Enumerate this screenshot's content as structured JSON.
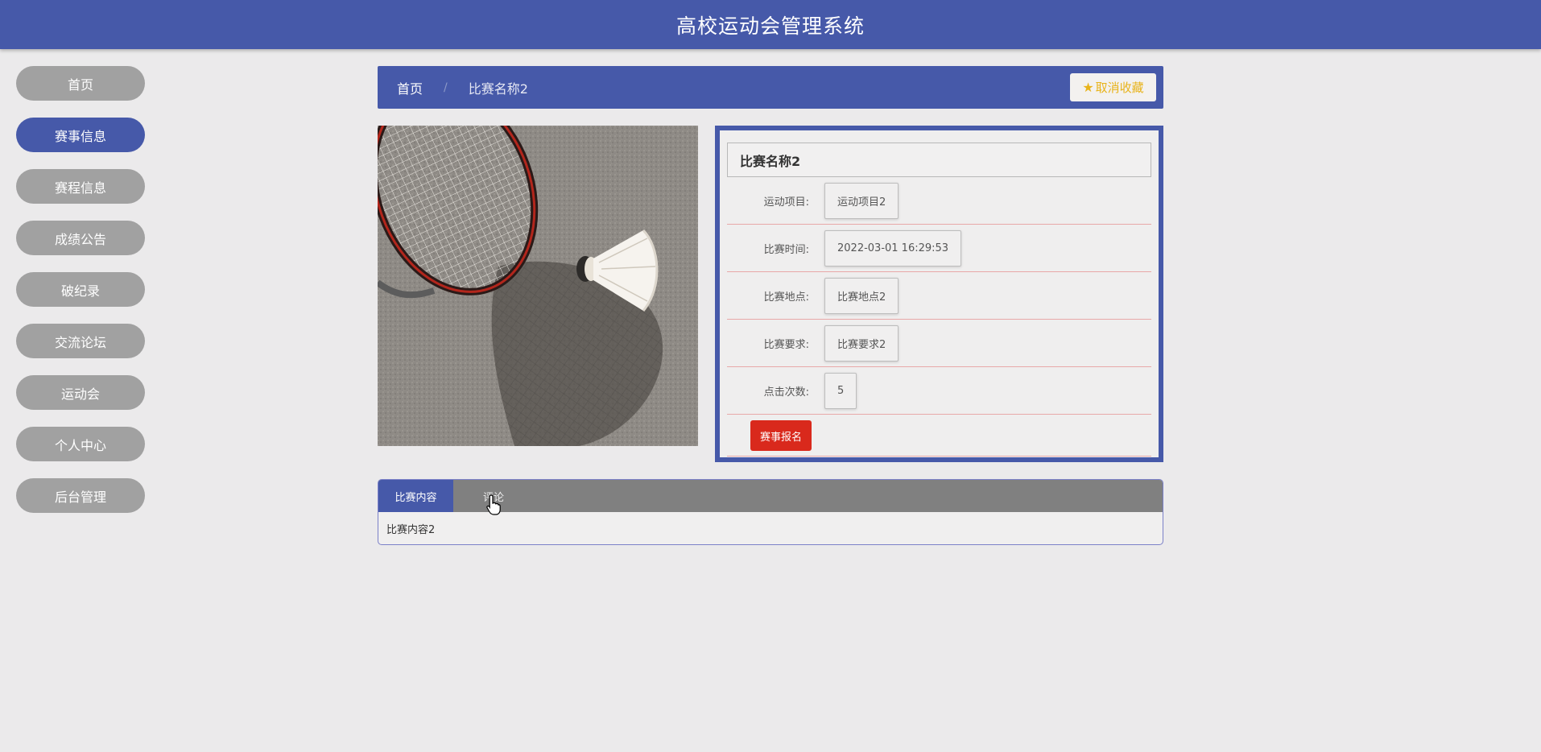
{
  "header": {
    "title": "高校运动会管理系统"
  },
  "sidebar": {
    "items": [
      {
        "label": "首页",
        "active": false
      },
      {
        "label": "赛事信息",
        "active": true
      },
      {
        "label": "赛程信息",
        "active": false
      },
      {
        "label": "成绩公告",
        "active": false
      },
      {
        "label": "破纪录",
        "active": false
      },
      {
        "label": "交流论坛",
        "active": false
      },
      {
        "label": "运动会",
        "active": false
      },
      {
        "label": "个人中心",
        "active": false
      },
      {
        "label": "后台管理",
        "active": false
      }
    ]
  },
  "breadcrumb": {
    "home": "首页",
    "separator": "/",
    "current": "比赛名称2"
  },
  "favorite": {
    "icon": "star-icon",
    "label": "取消收藏"
  },
  "detail": {
    "title": "比赛名称2",
    "rows": [
      {
        "label": "运动项目:",
        "value": "运动项目2"
      },
      {
        "label": "比赛时间:",
        "value": "2022-03-01 16:29:53"
      },
      {
        "label": "比赛地点:",
        "value": "比赛地点2"
      },
      {
        "label": "比赛要求:",
        "value": "比赛要求2"
      },
      {
        "label": "点击次数:",
        "value": "5"
      }
    ],
    "signup_label": "赛事报名"
  },
  "tabs": {
    "items": [
      {
        "label": "比赛内容"
      },
      {
        "label": "评论"
      }
    ],
    "content": "比赛内容2"
  },
  "colors": {
    "primary": "#4659a9",
    "danger": "#d9291c",
    "star": "#e8b31a",
    "nav_inactive": "#a1a1a1"
  }
}
